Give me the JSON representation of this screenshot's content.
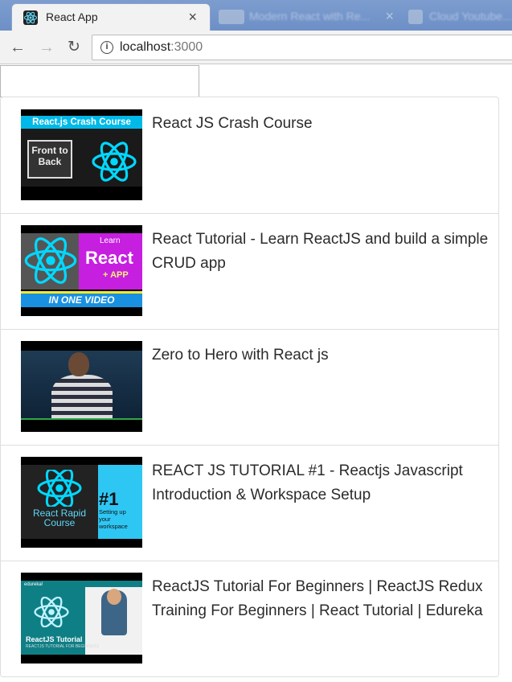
{
  "browser": {
    "tabs": [
      {
        "title": "React App",
        "active": true
      },
      {
        "title": "Modern React with Re...",
        "active": false
      },
      {
        "title": "Cloud Youtube...",
        "active": false
      }
    ],
    "address": {
      "host": "localhost",
      "port": ":3000"
    }
  },
  "search": {
    "value": "",
    "placeholder": ""
  },
  "videos": [
    {
      "title": "React JS Crash Course",
      "thumb": {
        "band": "React.js Crash Course",
        "box": "Front to Back"
      }
    },
    {
      "title": "React Tutorial - Learn ReactJS and build a simple CRUD app",
      "thumb": {
        "learn": "Learn",
        "react": "React",
        "app": "+ APP",
        "bottom": "IN ONE VIDEO"
      }
    },
    {
      "title": "Zero to Hero with React js",
      "thumb": {}
    },
    {
      "title": "REACT JS TUTORIAL #1 - Reactjs Javascript Introduction & Workspace Setup",
      "thumb": {
        "num": "#1",
        "small": "Setting up your workspace",
        "cap": "React Rapid Course"
      }
    },
    {
      "title": "ReactJS Tutorial For Beginners | ReactJS Redux Training For Beginners | React Tutorial | Edureka",
      "thumb": {
        "brand": "edureka!",
        "cap": "ReactJS Tutorial",
        "sub": "REACTJS TUTORIAL FOR BEGINNERS"
      }
    }
  ],
  "colors": {
    "react_blue": "#00d8ff",
    "accent_magenta": "#c61fe0"
  }
}
